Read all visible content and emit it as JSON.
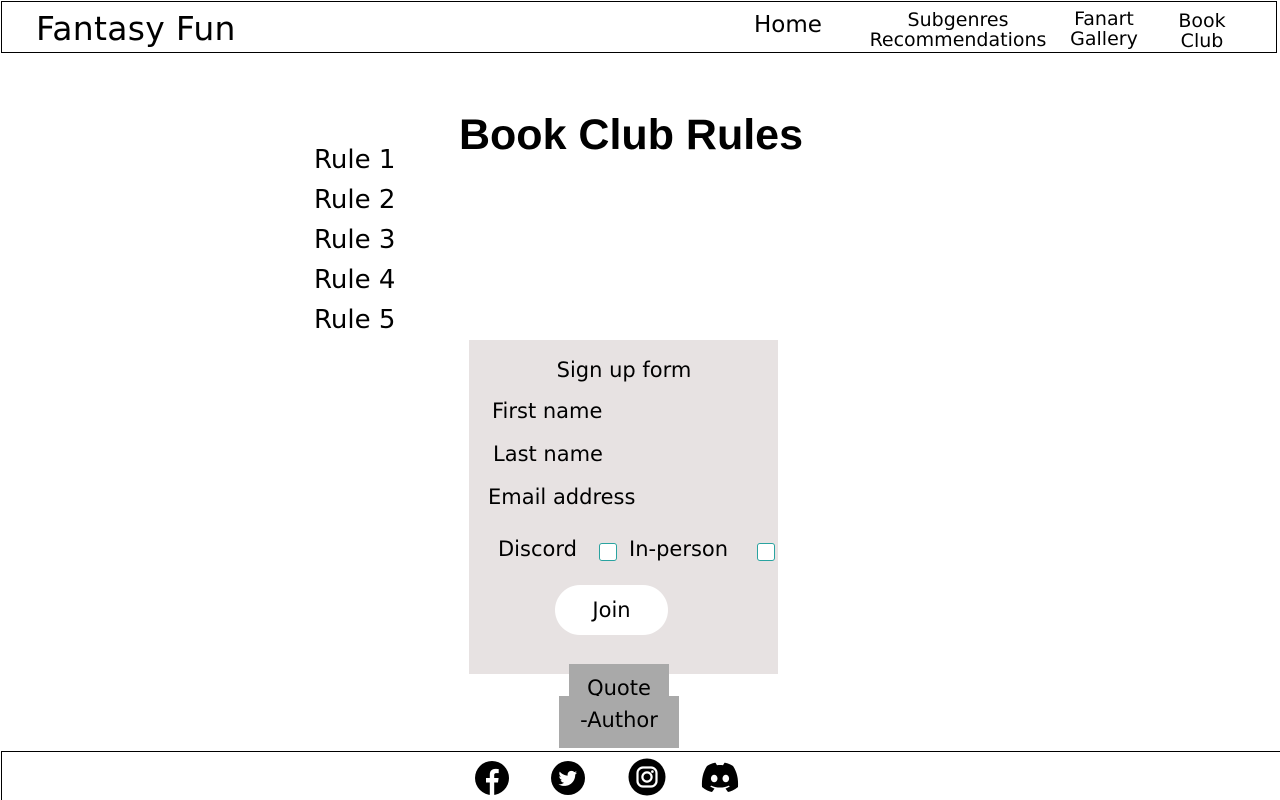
{
  "header": {
    "logo": "Fantasy Fun",
    "nav": {
      "home": "Home",
      "subgenres_line1": "Subgenres",
      "subgenres_line2": "Recommendations",
      "fanart_line1": "Fanart",
      "fanart_line2": "Gallery",
      "bookclub_line1": "Book",
      "bookclub_line2": "Club"
    }
  },
  "main": {
    "title": "Book Club Rules",
    "rules": [
      "Rule 1",
      "Rule 2",
      "Rule 3",
      "Rule 4",
      "Rule 5"
    ]
  },
  "form": {
    "title": "Sign up form",
    "first_name_label": "First name",
    "last_name_label": "Last name",
    "email_label": "Email address",
    "discord_label": "Discord",
    "inperson_label": "In-person",
    "join_label": "Join"
  },
  "quote": {
    "text": "Quote",
    "author": "-Author"
  },
  "footer": {
    "icons": [
      "facebook-icon",
      "twitter-icon",
      "instagram-icon",
      "discord-icon"
    ]
  },
  "colors": {
    "form_background": "#e7e2e2",
    "quote_background": "#a9a9a9",
    "checkbox_border": "#2aa3a0"
  }
}
